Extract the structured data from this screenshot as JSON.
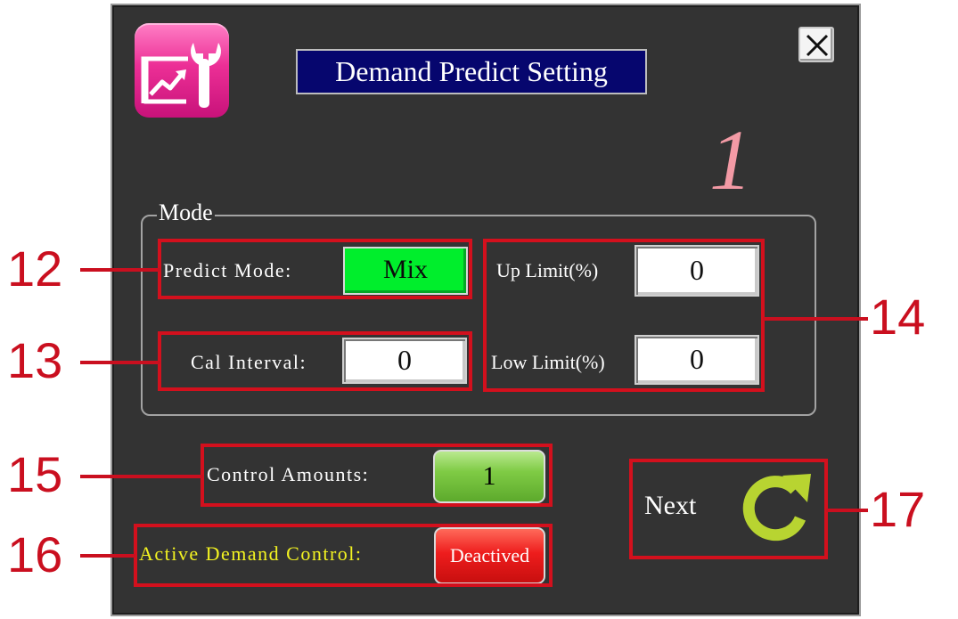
{
  "dialog": {
    "title": "Demand Predict Setting",
    "page_number": "1",
    "app_icon": "chart-wrench-icon",
    "close_icon": "close-icon"
  },
  "mode_group": {
    "legend": "Mode",
    "predict_mode": {
      "label": "Predict Mode:",
      "value": "Mix",
      "color": "#00ee2c"
    },
    "cal_interval": {
      "label": "Cal Interval:",
      "value": "0"
    },
    "up_limit": {
      "label": "Up Limit(%)",
      "value": "0"
    },
    "low_limit": {
      "label": "Low Limit(%)",
      "value": "0"
    }
  },
  "control_amounts": {
    "label": "Control Amounts:",
    "value": "1",
    "color": "#7fcb45"
  },
  "active_demand": {
    "label": "Active Demand Control:",
    "value": "Deactived",
    "label_color": "#f3f321",
    "button_color": "#ee1d1d"
  },
  "next": {
    "label": "Next",
    "icon": "refresh-arrow-icon",
    "icon_color": "#b8d431"
  },
  "callouts": [
    "12",
    "13",
    "14",
    "15",
    "16",
    "17"
  ],
  "colors": {
    "callout": "#ca0f1f",
    "panel_bg": "#333333",
    "title_bg": "#06066e"
  }
}
